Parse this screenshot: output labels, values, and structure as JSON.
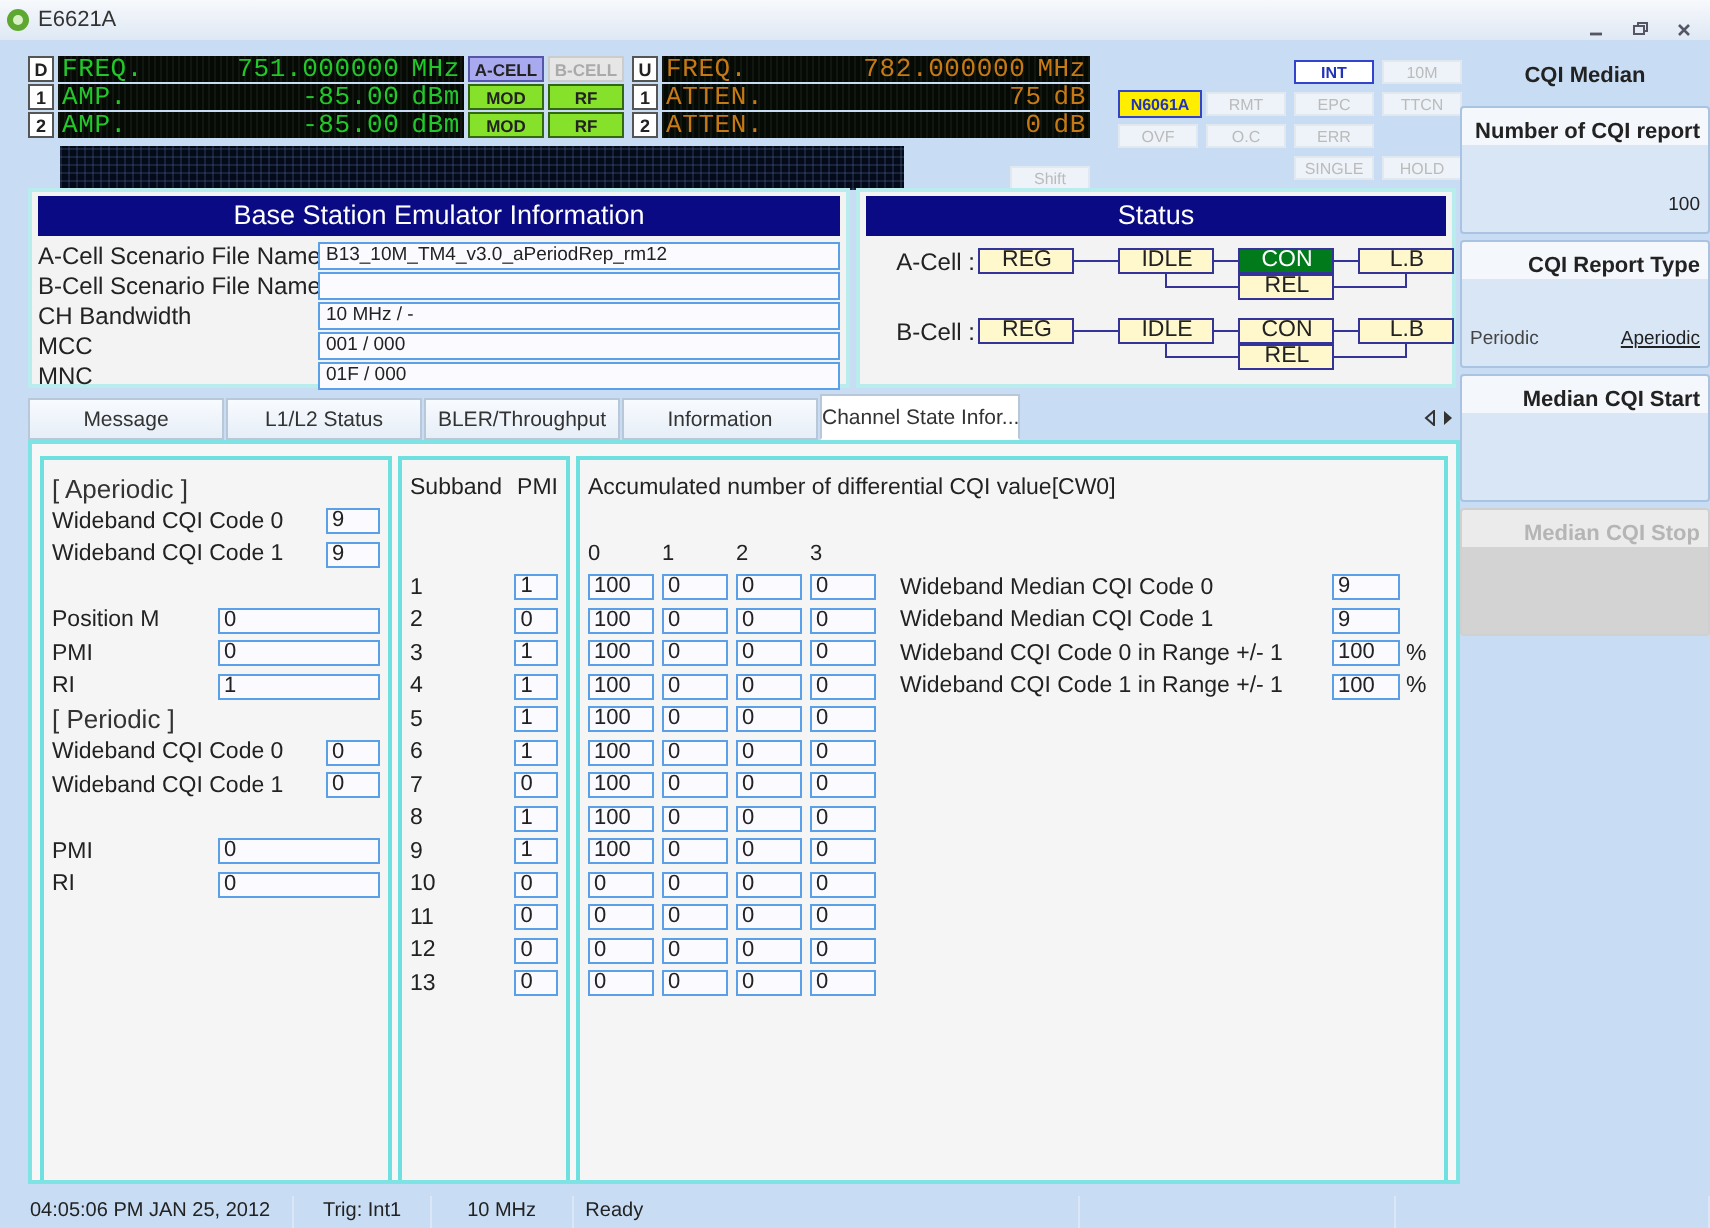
{
  "window": {
    "title": "E6621A"
  },
  "instrument": {
    "left_display": [
      {
        "tag": "D",
        "label": "FREQ.",
        "value": "751.000000",
        "unit": "MHz",
        "buttons": [
          {
            "label": "A-CELL",
            "kind": "cell",
            "on": true
          },
          {
            "label": "B-CELL",
            "kind": "cell",
            "on": false
          }
        ]
      },
      {
        "tag": "1",
        "label": "AMP.",
        "value": "-85.00",
        "unit": "dBm",
        "buttons": [
          {
            "label": "MOD",
            "kind": "signal",
            "on": true
          },
          {
            "label": "RF",
            "kind": "signal",
            "on": true
          }
        ]
      },
      {
        "tag": "2",
        "label": "AMP.",
        "value": "-85.00",
        "unit": "dBm",
        "buttons": [
          {
            "label": "MOD",
            "kind": "signal",
            "on": true
          },
          {
            "label": "RF",
            "kind": "signal",
            "on": true
          }
        ]
      }
    ],
    "right_display": [
      {
        "tag": "U",
        "label": "FREQ.",
        "value": "782.000000",
        "unit": "MHz"
      },
      {
        "tag": "1",
        "label": "ATTEN.",
        "value": "75",
        "unit": "dB"
      },
      {
        "tag": "2",
        "label": "ATTEN.",
        "value": "0",
        "unit": "dB"
      }
    ],
    "shift_button": {
      "label": "Shift",
      "on": false
    },
    "buttons": [
      {
        "label": "INT",
        "on": true
      },
      {
        "label": "10M",
        "on": false
      },
      {
        "label": "N6061A",
        "on": true
      },
      {
        "label": "RMT",
        "on": false
      },
      {
        "label": "EPC",
        "on": false
      },
      {
        "label": "TTCN",
        "on": false
      },
      {
        "label": "OVF",
        "on": false
      },
      {
        "label": "O.C",
        "on": false
      },
      {
        "label": "ERR",
        "on": false
      },
      {
        "label": "SINGLE",
        "on": false
      },
      {
        "label": "HOLD",
        "on": false
      }
    ]
  },
  "info": {
    "title": "Base Station Emulator Information",
    "rows": [
      {
        "label": "A-Cell Scenario File Name",
        "value": "B13_10M_TM4_v3.0_aPeriodRep_rm12"
      },
      {
        "label": "B-Cell Scenario File Name"
      },
      {
        "label": "CH Bandwidth",
        "value": "10 MHz / -"
      },
      {
        "label": "MCC",
        "value": "001 / 000"
      },
      {
        "label": "MNC",
        "value": "01F / 000"
      }
    ]
  },
  "status": {
    "title": "Status",
    "cells": [
      {
        "label": "A-Cell :",
        "states": [
          {
            "label": "REG",
            "selected": false
          },
          {
            "label": "IDLE",
            "selected": false
          },
          {
            "label": "CON",
            "selected": true
          },
          {
            "label": "L.B",
            "selected": false
          },
          {
            "label": "REL",
            "selected": false
          }
        ]
      },
      {
        "label": "B-Cell :",
        "states": [
          {
            "label": "REG",
            "selected": false
          },
          {
            "label": "IDLE",
            "selected": false
          },
          {
            "label": "CON",
            "selected": false
          },
          {
            "label": "L.B",
            "selected": false
          },
          {
            "label": "REL",
            "selected": false
          }
        ]
      }
    ]
  },
  "tabs": [
    {
      "label": "Message",
      "selected": false
    },
    {
      "label": "L1/L2 Status",
      "selected": false
    },
    {
      "label": "BLER/Throughput",
      "selected": false
    },
    {
      "label": "Information",
      "selected": false
    },
    {
      "label": "Channel State Infor...",
      "selected": true
    }
  ],
  "cqi": {
    "left_blocks": [
      [
        {
          "kind": "heading",
          "label": "[ Aperiodic ]"
        },
        {
          "kind": "short",
          "label": "Wideband CQI Code 0",
          "value": "9"
        },
        {
          "kind": "short",
          "label": "Wideband CQI Code 1",
          "value": "9"
        }
      ],
      [
        {
          "kind": "long",
          "label": "Position M",
          "value": "0"
        },
        {
          "kind": "long",
          "label": "PMI",
          "value": "0"
        },
        {
          "kind": "long",
          "label": "RI",
          "value": "1"
        },
        {
          "kind": "heading",
          "label": "[ Periodic ]"
        },
        {
          "kind": "short",
          "label": "Wideband CQI Code 0",
          "value": "0"
        },
        {
          "kind": "short",
          "label": "Wideband CQI Code 1",
          "value": "0"
        }
      ],
      [
        {
          "kind": "long",
          "label": "PMI",
          "value": "0"
        },
        {
          "kind": "long",
          "label": "RI",
          "value": "0"
        }
      ]
    ],
    "subband": {
      "headers": [
        "Subband",
        "PMI"
      ],
      "rows": [
        {
          "index": "1",
          "pmi": "1"
        },
        {
          "index": "2",
          "pmi": "0"
        },
        {
          "index": "3",
          "pmi": "1"
        },
        {
          "index": "4",
          "pmi": "1"
        },
        {
          "index": "5",
          "pmi": "1"
        },
        {
          "index": "6",
          "pmi": "1"
        },
        {
          "index": "7",
          "pmi": "0"
        },
        {
          "index": "8",
          "pmi": "1"
        },
        {
          "index": "9",
          "pmi": "1"
        },
        {
          "index": "10",
          "pmi": "0"
        },
        {
          "index": "11",
          "pmi": "0"
        },
        {
          "index": "12",
          "pmi": "0"
        },
        {
          "index": "13",
          "pmi": "0"
        }
      ]
    },
    "accumulated": {
      "title": "Accumulated number of differential CQI value[CW0]",
      "columns": [
        "0",
        "1",
        "2",
        "3"
      ],
      "rows": [
        [
          "100",
          "0",
          "0",
          "0"
        ],
        [
          "100",
          "0",
          "0",
          "0"
        ],
        [
          "100",
          "0",
          "0",
          "0"
        ],
        [
          "100",
          "0",
          "0",
          "0"
        ],
        [
          "100",
          "0",
          "0",
          "0"
        ],
        [
          "100",
          "0",
          "0",
          "0"
        ],
        [
          "100",
          "0",
          "0",
          "0"
        ],
        [
          "100",
          "0",
          "0",
          "0"
        ],
        [
          "100",
          "0",
          "0",
          "0"
        ],
        [
          "0",
          "0",
          "0",
          "0"
        ],
        [
          "0",
          "0",
          "0",
          "0"
        ],
        [
          "0",
          "0",
          "0",
          "0"
        ],
        [
          "0",
          "0",
          "0",
          "0"
        ]
      ]
    },
    "metrics": [
      {
        "label": "Wideband Median CQI Code 0",
        "value": "9"
      },
      {
        "label": "Wideband Median CQI Code 1",
        "value": "9"
      },
      {
        "label": "Wideband CQI Code 0 in Range +/- 1",
        "value": "100",
        "unit": "%"
      },
      {
        "label": "Wideband CQI Code 1 in Range +/- 1",
        "value": "100",
        "unit": "%"
      }
    ]
  },
  "sidebar": {
    "title": "CQI Median",
    "report_count": {
      "title": "Number of CQI report",
      "value": "100"
    },
    "report_type": {
      "title": "CQI Report Type",
      "options": [
        {
          "label": "Periodic",
          "selected": false
        },
        {
          "label": "Aperiodic",
          "selected": true
        }
      ]
    },
    "start_button": {
      "label": "Median CQI Start",
      "disabled": false
    },
    "stop_button": {
      "label": "Median CQI Stop",
      "disabled": true
    }
  },
  "status_bar": [
    "04:05:06 PM JAN 25, 2012",
    "Trig: Int1",
    "10 MHz",
    "Ready"
  ]
}
